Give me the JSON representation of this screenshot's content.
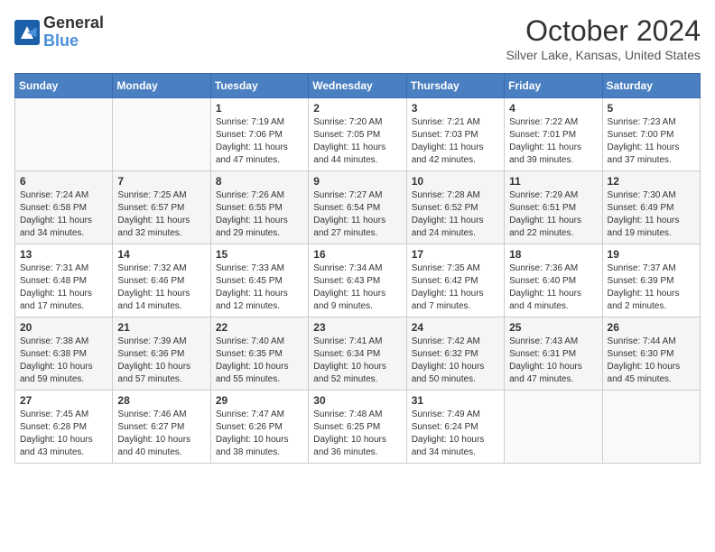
{
  "logo": {
    "general": "General",
    "blue": "Blue"
  },
  "title": "October 2024",
  "location": "Silver Lake, Kansas, United States",
  "headers": [
    "Sunday",
    "Monday",
    "Tuesday",
    "Wednesday",
    "Thursday",
    "Friday",
    "Saturday"
  ],
  "weeks": [
    [
      {
        "day": "",
        "info": ""
      },
      {
        "day": "",
        "info": ""
      },
      {
        "day": "1",
        "info": "Sunrise: 7:19 AM\nSunset: 7:06 PM\nDaylight: 11 hours and 47 minutes."
      },
      {
        "day": "2",
        "info": "Sunrise: 7:20 AM\nSunset: 7:05 PM\nDaylight: 11 hours and 44 minutes."
      },
      {
        "day": "3",
        "info": "Sunrise: 7:21 AM\nSunset: 7:03 PM\nDaylight: 11 hours and 42 minutes."
      },
      {
        "day": "4",
        "info": "Sunrise: 7:22 AM\nSunset: 7:01 PM\nDaylight: 11 hours and 39 minutes."
      },
      {
        "day": "5",
        "info": "Sunrise: 7:23 AM\nSunset: 7:00 PM\nDaylight: 11 hours and 37 minutes."
      }
    ],
    [
      {
        "day": "6",
        "info": "Sunrise: 7:24 AM\nSunset: 6:58 PM\nDaylight: 11 hours and 34 minutes."
      },
      {
        "day": "7",
        "info": "Sunrise: 7:25 AM\nSunset: 6:57 PM\nDaylight: 11 hours and 32 minutes."
      },
      {
        "day": "8",
        "info": "Sunrise: 7:26 AM\nSunset: 6:55 PM\nDaylight: 11 hours and 29 minutes."
      },
      {
        "day": "9",
        "info": "Sunrise: 7:27 AM\nSunset: 6:54 PM\nDaylight: 11 hours and 27 minutes."
      },
      {
        "day": "10",
        "info": "Sunrise: 7:28 AM\nSunset: 6:52 PM\nDaylight: 11 hours and 24 minutes."
      },
      {
        "day": "11",
        "info": "Sunrise: 7:29 AM\nSunset: 6:51 PM\nDaylight: 11 hours and 22 minutes."
      },
      {
        "day": "12",
        "info": "Sunrise: 7:30 AM\nSunset: 6:49 PM\nDaylight: 11 hours and 19 minutes."
      }
    ],
    [
      {
        "day": "13",
        "info": "Sunrise: 7:31 AM\nSunset: 6:48 PM\nDaylight: 11 hours and 17 minutes."
      },
      {
        "day": "14",
        "info": "Sunrise: 7:32 AM\nSunset: 6:46 PM\nDaylight: 11 hours and 14 minutes."
      },
      {
        "day": "15",
        "info": "Sunrise: 7:33 AM\nSunset: 6:45 PM\nDaylight: 11 hours and 12 minutes."
      },
      {
        "day": "16",
        "info": "Sunrise: 7:34 AM\nSunset: 6:43 PM\nDaylight: 11 hours and 9 minutes."
      },
      {
        "day": "17",
        "info": "Sunrise: 7:35 AM\nSunset: 6:42 PM\nDaylight: 11 hours and 7 minutes."
      },
      {
        "day": "18",
        "info": "Sunrise: 7:36 AM\nSunset: 6:40 PM\nDaylight: 11 hours and 4 minutes."
      },
      {
        "day": "19",
        "info": "Sunrise: 7:37 AM\nSunset: 6:39 PM\nDaylight: 11 hours and 2 minutes."
      }
    ],
    [
      {
        "day": "20",
        "info": "Sunrise: 7:38 AM\nSunset: 6:38 PM\nDaylight: 10 hours and 59 minutes."
      },
      {
        "day": "21",
        "info": "Sunrise: 7:39 AM\nSunset: 6:36 PM\nDaylight: 10 hours and 57 minutes."
      },
      {
        "day": "22",
        "info": "Sunrise: 7:40 AM\nSunset: 6:35 PM\nDaylight: 10 hours and 55 minutes."
      },
      {
        "day": "23",
        "info": "Sunrise: 7:41 AM\nSunset: 6:34 PM\nDaylight: 10 hours and 52 minutes."
      },
      {
        "day": "24",
        "info": "Sunrise: 7:42 AM\nSunset: 6:32 PM\nDaylight: 10 hours and 50 minutes."
      },
      {
        "day": "25",
        "info": "Sunrise: 7:43 AM\nSunset: 6:31 PM\nDaylight: 10 hours and 47 minutes."
      },
      {
        "day": "26",
        "info": "Sunrise: 7:44 AM\nSunset: 6:30 PM\nDaylight: 10 hours and 45 minutes."
      }
    ],
    [
      {
        "day": "27",
        "info": "Sunrise: 7:45 AM\nSunset: 6:28 PM\nDaylight: 10 hours and 43 minutes."
      },
      {
        "day": "28",
        "info": "Sunrise: 7:46 AM\nSunset: 6:27 PM\nDaylight: 10 hours and 40 minutes."
      },
      {
        "day": "29",
        "info": "Sunrise: 7:47 AM\nSunset: 6:26 PM\nDaylight: 10 hours and 38 minutes."
      },
      {
        "day": "30",
        "info": "Sunrise: 7:48 AM\nSunset: 6:25 PM\nDaylight: 10 hours and 36 minutes."
      },
      {
        "day": "31",
        "info": "Sunrise: 7:49 AM\nSunset: 6:24 PM\nDaylight: 10 hours and 34 minutes."
      },
      {
        "day": "",
        "info": ""
      },
      {
        "day": "",
        "info": ""
      }
    ]
  ]
}
